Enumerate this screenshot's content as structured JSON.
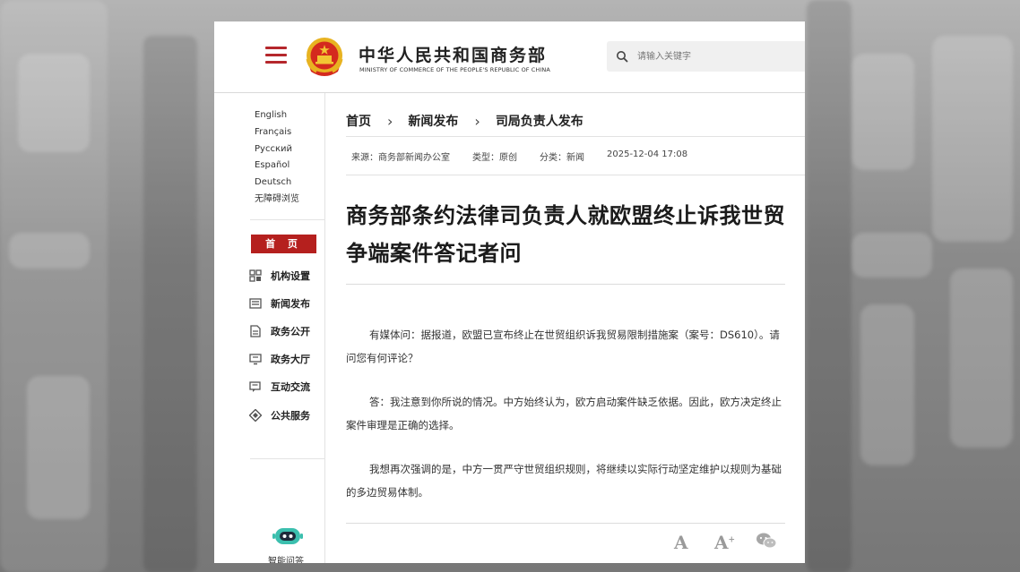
{
  "header": {
    "title_cn": "中华人民共和国商务部",
    "title_en": "MINISTRY OF COMMERCE OF THE PEOPLE'S REPUBLIC OF CHINA",
    "search_placeholder": "请输入关键字"
  },
  "sidebar": {
    "languages": [
      "English",
      "Français",
      "Русский",
      "Español",
      "Deutsch",
      "无障碍浏览"
    ],
    "home_label": "首 页",
    "nav_items": [
      {
        "label": "机构设置",
        "icon": "org-icon"
      },
      {
        "label": "新闻发布",
        "icon": "news-icon"
      },
      {
        "label": "政务公开",
        "icon": "document-icon"
      },
      {
        "label": "政务大厅",
        "icon": "hall-icon"
      },
      {
        "label": "互动交流",
        "icon": "chat-icon"
      },
      {
        "label": "公共服务",
        "icon": "service-icon"
      }
    ],
    "assistant_label": "智能问答"
  },
  "breadcrumb": [
    "首页",
    "新闻发布",
    "司局负责人发布"
  ],
  "meta": {
    "source": "来源：商务部新闻办公室",
    "type": "类型：原创",
    "category": "分类：新闻",
    "datetime": "2025-12-04 17:08"
  },
  "article": {
    "title": "商务部条约法律司负责人就欧盟终止诉我世贸争端案件答记者问",
    "paragraphs": [
      "有媒体问：据报道，欧盟已宣布终止在世贸组织诉我贸易限制措施案（案号：DS610）。请问您有何评论？",
      "答：我注意到你所说的情况。中方始终认为，欧方启动案件缺乏依据。因此，欧方决定终止案件审理是正确的选择。",
      "我想再次强调的是，中方一贯严守世贸组织规则，将继续以实际行动坚定维护以规则为基础的多边贸易体制。"
    ]
  },
  "tools": {
    "font_small": "A",
    "font_large": "A",
    "font_large_mark": "+"
  },
  "colors": {
    "accent_red": "#b5201e",
    "emblem_gold": "#e8b321"
  }
}
